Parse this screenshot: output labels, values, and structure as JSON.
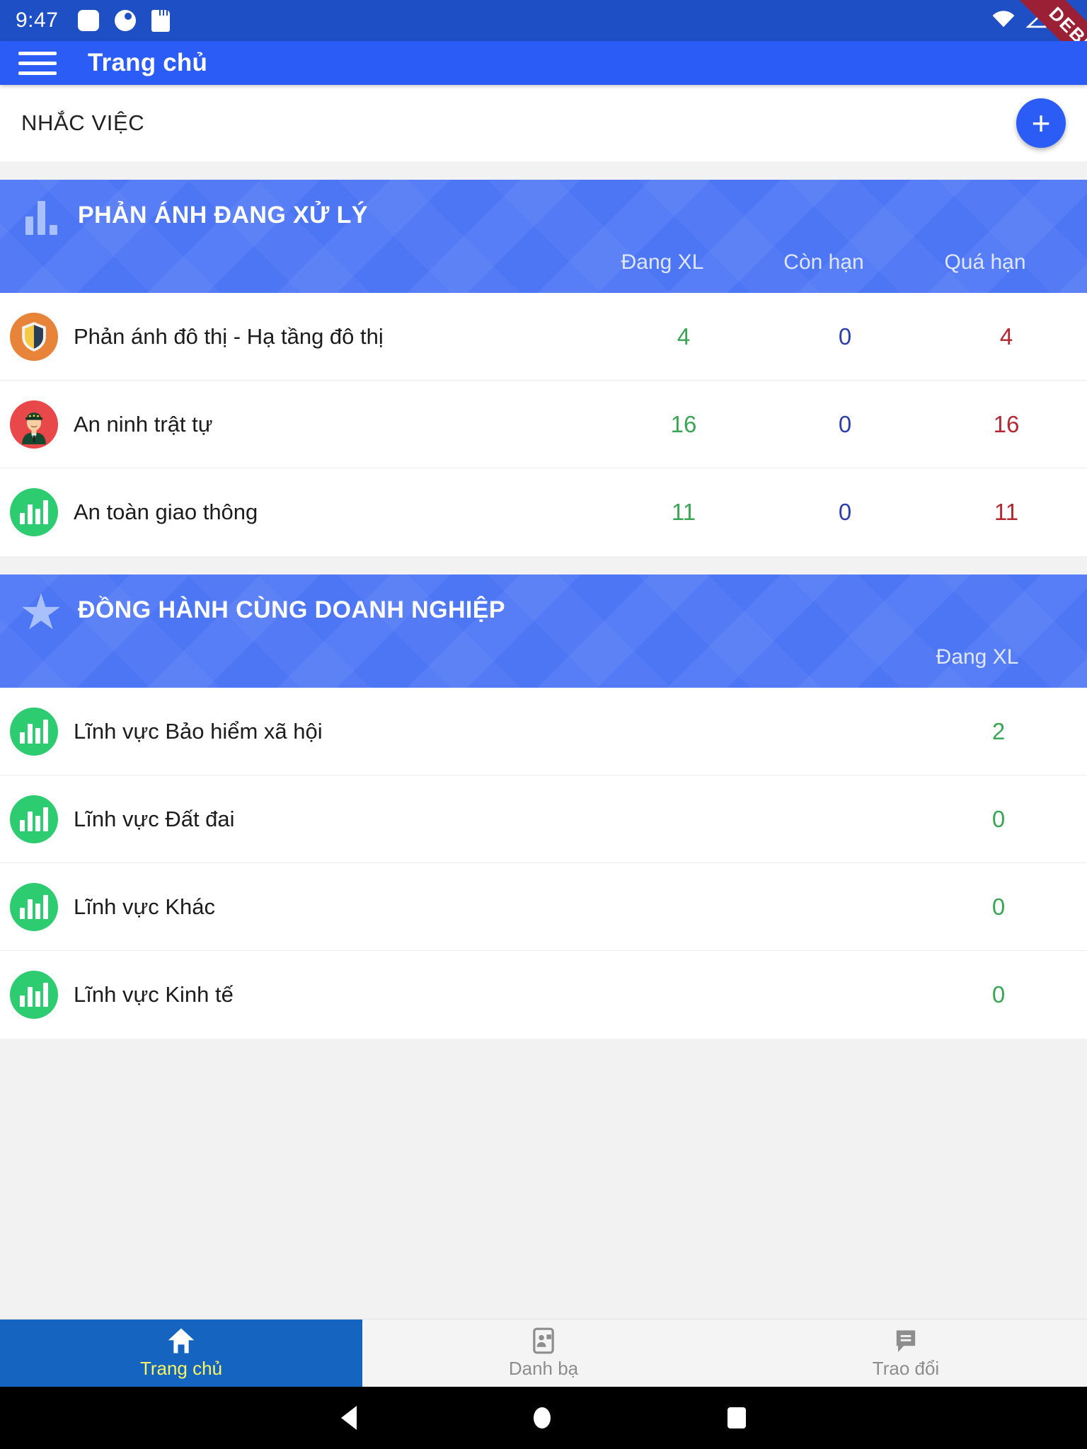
{
  "statusbar": {
    "time": "9:47",
    "icons": [
      "rounded-square-icon",
      "circle-dot-icon",
      "sd-card-icon"
    ],
    "right_icons": [
      "wifi-icon",
      "cell-signal-icon",
      "battery-icon"
    ],
    "debug_banner": "DEBUG"
  },
  "appbar": {
    "menu_icon": "hamburger-menu-icon",
    "title": "Trang chủ"
  },
  "reminder": {
    "title": "NHẮC VIỆC",
    "add_label": "+"
  },
  "cards": [
    {
      "icon": "bar-chart-icon",
      "title": "PHẢN ÁNH ĐANG XỬ LÝ",
      "columns": [
        "Đang XL",
        "Còn hạn",
        "Quá hạn"
      ],
      "rows": [
        {
          "avatar": "shield-orange-icon",
          "label": "Phản ánh đô thị - Hạ tầng đô thị",
          "values": [
            "4",
            "0",
            "4"
          ]
        },
        {
          "avatar": "police-officer-icon",
          "label": "An ninh trật tự",
          "values": [
            "16",
            "0",
            "16"
          ]
        },
        {
          "avatar": "bar-chart-green-icon",
          "label": "An toàn giao thông",
          "values": [
            "11",
            "0",
            "11"
          ]
        }
      ]
    },
    {
      "icon": "star-icon",
      "title": "ĐỒNG HÀNH CÙNG DOANH NGHIỆP",
      "columns": [
        "Đang XL"
      ],
      "rows": [
        {
          "avatar": "bar-chart-green-icon",
          "label": "Lĩnh vực Bảo hiểm xã hội",
          "values": [
            "2"
          ]
        },
        {
          "avatar": "bar-chart-green-icon",
          "label": "Lĩnh vực Đất đai",
          "values": [
            "0"
          ]
        },
        {
          "avatar": "bar-chart-green-icon",
          "label": "Lĩnh vực Khác",
          "values": [
            "0"
          ]
        },
        {
          "avatar": "bar-chart-green-icon",
          "label": "Lĩnh vực Kinh tế",
          "values": [
            "0"
          ]
        }
      ]
    }
  ],
  "bottomnav": [
    {
      "icon": "home-icon",
      "label": "Trang chủ",
      "active": true
    },
    {
      "icon": "contacts-icon",
      "label": "Danh bạ",
      "active": false
    },
    {
      "icon": "chat-icon",
      "label": "Trao đổi",
      "active": false
    }
  ],
  "colors": {
    "appbar": "#2b5cf6",
    "statusbar": "#1f4fc4",
    "card_header": "#4d76f5",
    "accent_green": "#3aa655",
    "accent_blue": "#2f3fa8",
    "accent_red": "#b32832",
    "nav_active_bg": "#1565c0",
    "nav_active_text": "#fbf463",
    "debug": "#9c2035"
  }
}
